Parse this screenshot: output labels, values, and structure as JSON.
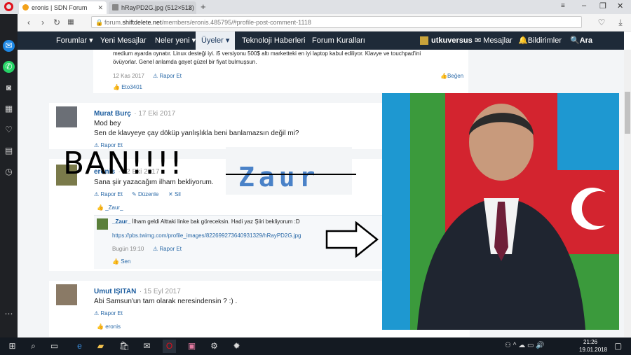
{
  "browser": {
    "tabs": [
      {
        "title": "eronis | SDN Forum"
      },
      {
        "title": "hRayPD2G.jpg (512×512)"
      }
    ],
    "new_tab": "+",
    "url_prefix": "forum.",
    "url_host": "shiftdelete.net",
    "url_path": "/members/eronis.485795/#profile-post-comment-1118",
    "window_controls": {
      "min": "–",
      "max": "❐",
      "close": "✕"
    }
  },
  "site_nav": {
    "items": [
      "Forumlar",
      "Yeni Mesajlar",
      "Neler yeni",
      "Üyeler",
      "Teknoloji Haberleri",
      "Forum Kuralları"
    ],
    "active": "Üyeler",
    "user": "utkuversus",
    "messages": "Mesajlar",
    "notifications": "Bildirimler",
    "search": "Ara"
  },
  "posts": {
    "top_comment": {
      "text1": "medium ayarda oynatır. Linux desteği iyi. i5 versiyonu 500$ altı marketteki en iyi laptop kabul ediliyor. Klavye ve touchpad'ini",
      "text2": "övüyorlar. Genel anlamda gayet güzel bir fiyat bulmuşsun.",
      "date": "12 Kas 2017",
      "report": "Rapor Et",
      "like": "Beğen",
      "liker": "Eto3401"
    },
    "post1": {
      "author": "Murat Burç",
      "date": "· 17 Eki 2017",
      "line1": "Mod bey",
      "line2": "Sen de klavyeye çay döküp yanlışlıkla beni banlamazsın değil mi?",
      "report": "Rapor Et"
    },
    "post2": {
      "author": "eronis",
      "date": "· 12 Eki 2017",
      "text": "Sana şiir yazacağım ilham bekliyorum.",
      "report": "Rapor Et",
      "edit": "Düzenle",
      "delete": "Sil",
      "liker": "_Zaur_",
      "comment_author": "_Zaur_",
      "comment_text": "İlham geldi Alttaki linke bak göreceksin. Hadi yaz Şiiri bekliyorum :D",
      "comment_link": "https://pbs.twimg.com/profile_images/822699273640931329/hRayPD2G.jpg",
      "comment_date": "Bugün 19:10",
      "comment_report": "Rapor Et",
      "comment_liker": "Sen"
    },
    "post3": {
      "author": "Umut IŞITAN",
      "date": "· 15 Eyl 2017",
      "text": "Abi Samsun'un tam olarak neresindensin ? :) .",
      "report": "Rapor Et",
      "liker": "eronis"
    }
  },
  "overlay": {
    "ban_text": "BAN!!!!",
    "pixel_text": "Zaur"
  },
  "taskbar": {
    "time": "21:26",
    "date": "19.01.2018"
  },
  "colors": {
    "nav_bg": "#1e2a38",
    "link": "#1b5c9e",
    "flag_red": "#d3242f",
    "flag_blue": "#1e98d1",
    "flag_green": "#3b9a3c"
  }
}
